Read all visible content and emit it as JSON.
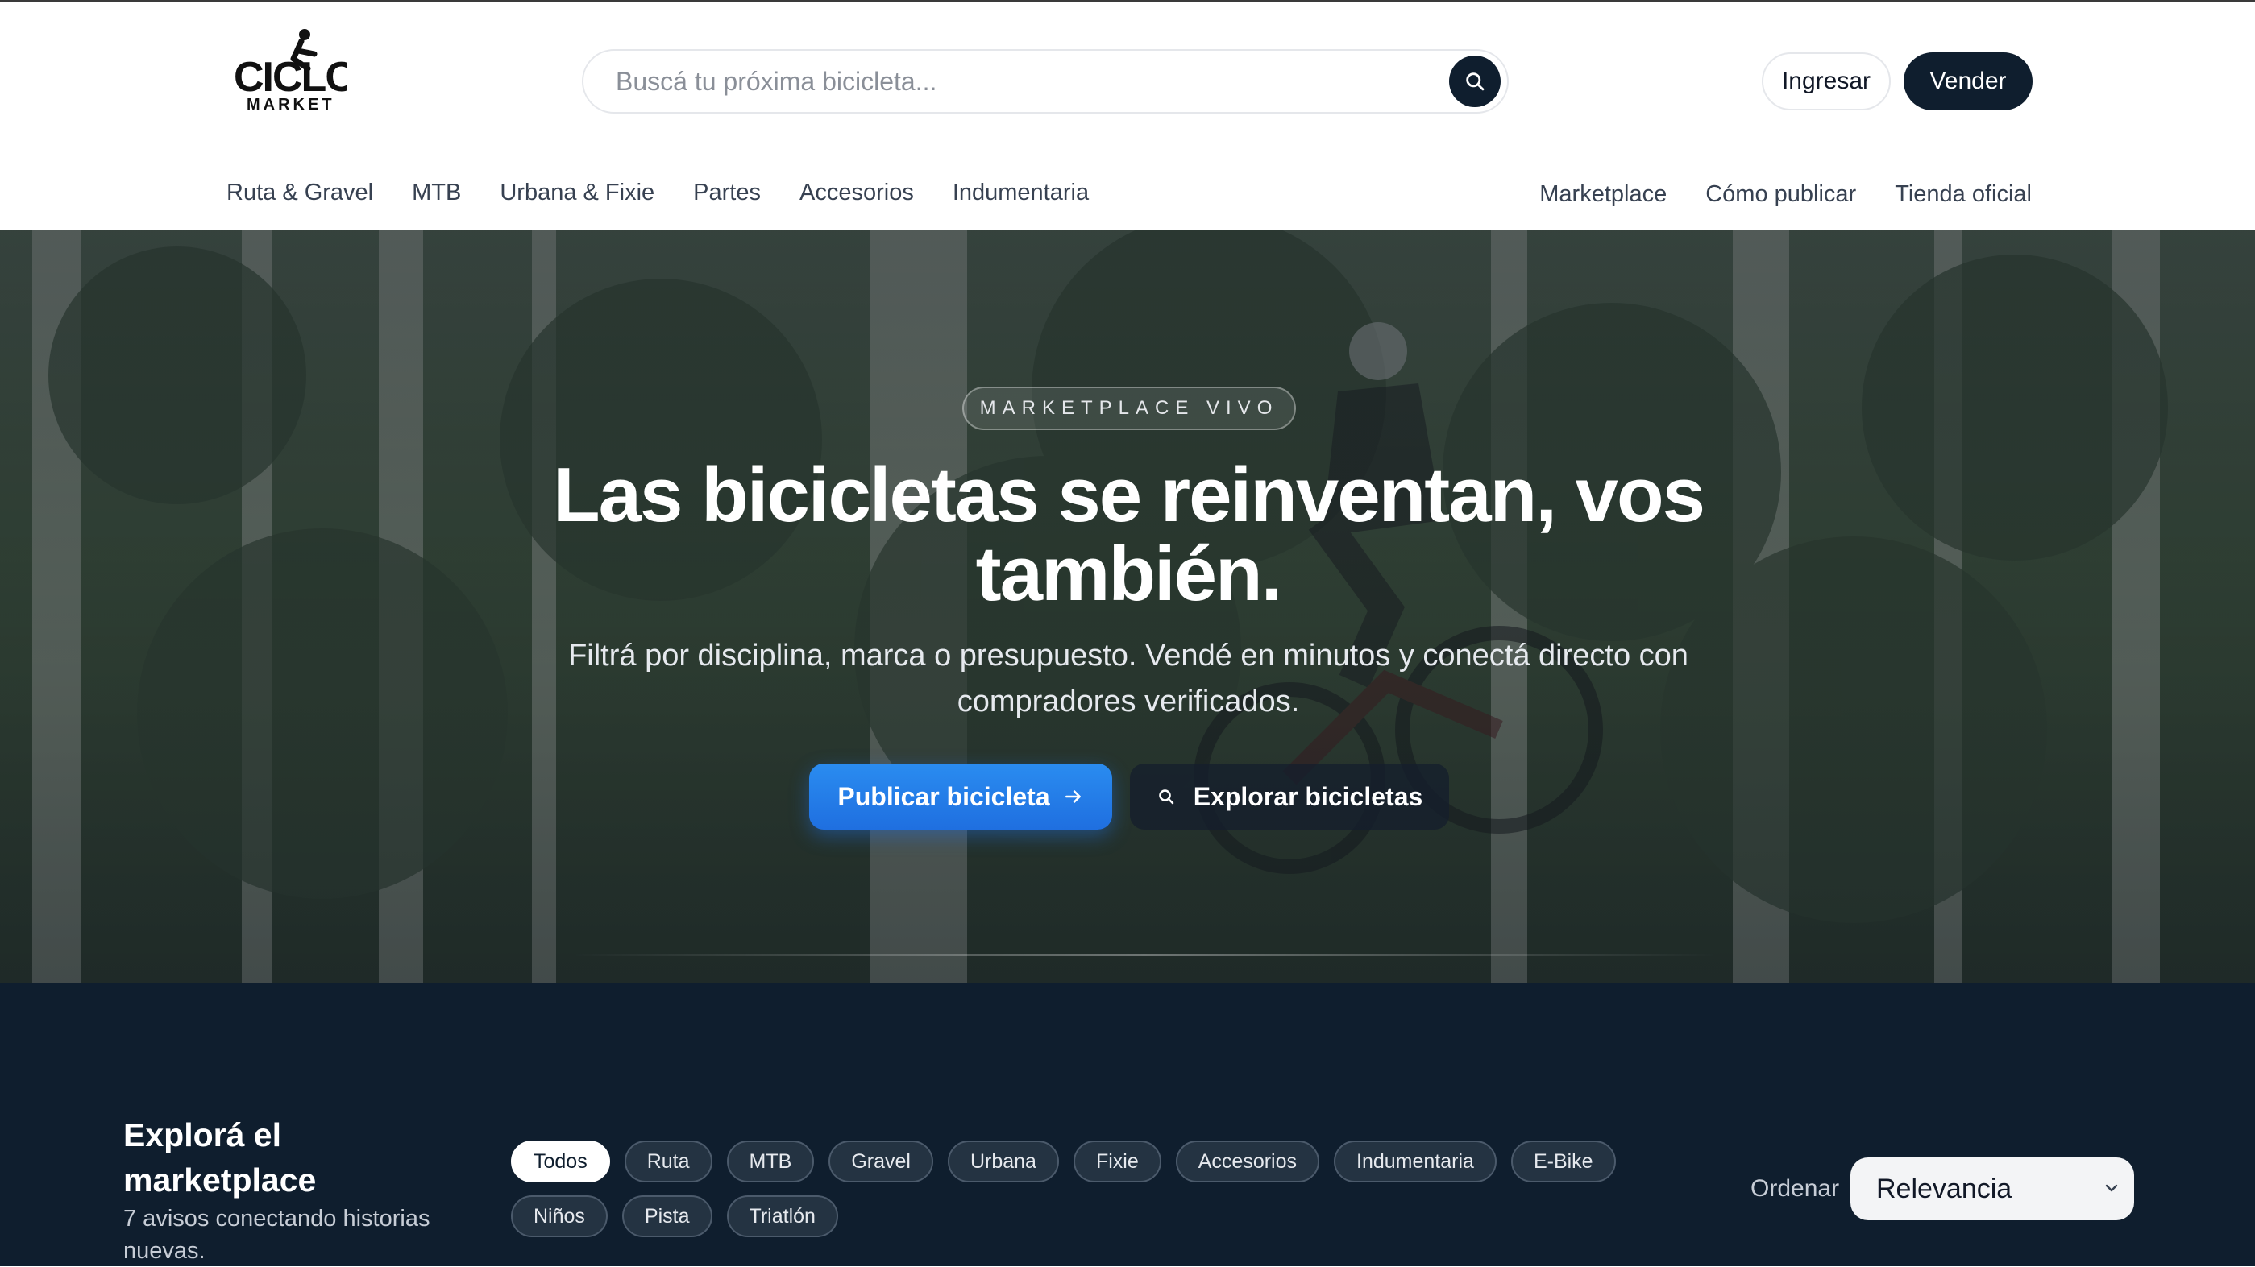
{
  "header": {
    "logo_text": "CICLO MARKET",
    "search": {
      "placeholder": "Buscá tu próxima bicicleta...",
      "value": ""
    },
    "login_label": "Ingresar",
    "sell_label": "Vender"
  },
  "nav": {
    "left": [
      {
        "label": "Ruta & Gravel"
      },
      {
        "label": "MTB"
      },
      {
        "label": "Urbana & Fixie"
      },
      {
        "label": "Partes"
      },
      {
        "label": "Accesorios"
      },
      {
        "label": "Indumentaria"
      }
    ],
    "right": [
      {
        "label": "Marketplace"
      },
      {
        "label": "Cómo publicar"
      },
      {
        "label": "Tienda oficial"
      }
    ]
  },
  "hero": {
    "eyebrow": "MARKETPLACE VIVO",
    "title": "Las bicicletas se reinventan, vos también.",
    "subtitle": "Filtrá por disciplina, marca o presupuesto. Vendé en minutos y conectá directo con compradores verificados.",
    "primary_cta": "Publicar bicicleta",
    "secondary_cta": "Explorar bicicletas"
  },
  "market": {
    "title": "Explorá el marketplace",
    "subtitle": "7 avisos conectando historias nuevas.",
    "filters": [
      {
        "label": "Todos",
        "active": true
      },
      {
        "label": "Ruta",
        "active": false
      },
      {
        "label": "MTB",
        "active": false
      },
      {
        "label": "Gravel",
        "active": false
      },
      {
        "label": "Urbana",
        "active": false
      },
      {
        "label": "Fixie",
        "active": false
      },
      {
        "label": "Accesorios",
        "active": false
      },
      {
        "label": "Indumentaria",
        "active": false
      },
      {
        "label": "E-Bike",
        "active": false
      },
      {
        "label": "Niños",
        "active": false
      },
      {
        "label": "Pista",
        "active": false
      },
      {
        "label": "Triatlón",
        "active": false
      }
    ],
    "sort_label": "Ordenar",
    "sort_value": "Relevancia"
  },
  "colors": {
    "brand_dark": "#0f1e2e",
    "accent_blue": "#1f6fe0",
    "white": "#ffffff"
  },
  "icons": {
    "search": "search-icon",
    "arrow": "arrow-right-icon",
    "chevron": "chevron-down-icon",
    "logo": "cyclist-logo"
  }
}
